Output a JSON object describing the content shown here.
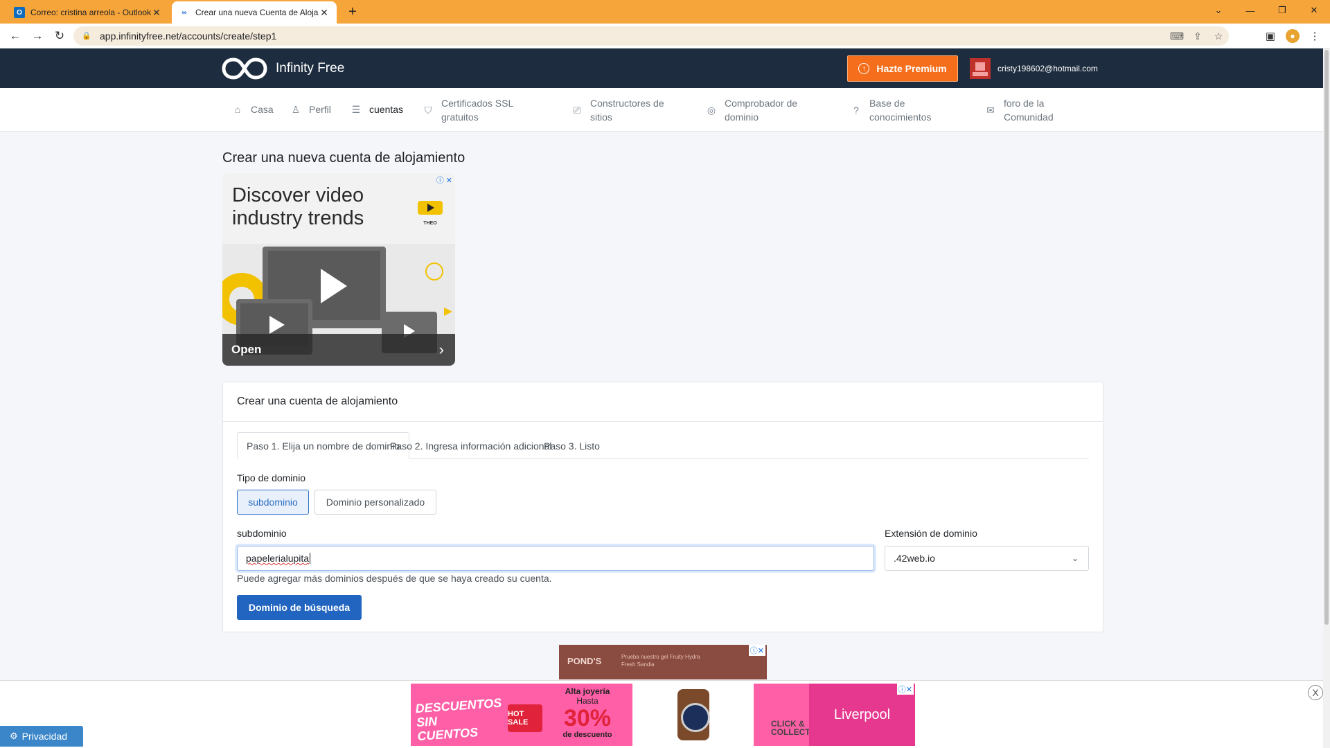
{
  "browser": {
    "tabs": [
      {
        "title": "Correo: cristina arreola - Outlook",
        "icon": "outlook-icon"
      },
      {
        "title": "Crear una nueva Cuenta de Alojamiento",
        "icon": "infinityfree-icon"
      }
    ],
    "new_tab": "+",
    "url": "app.infinityfree.net/accounts/create/step1"
  },
  "header": {
    "logo_text": "Infinity Free",
    "premium_label": "Hazte Premium",
    "user_email": "cristy198602@hotmail.com"
  },
  "nav": {
    "items": [
      {
        "label": "Casa",
        "icon": "home-icon"
      },
      {
        "label": "Perfil",
        "icon": "user-icon"
      },
      {
        "label": "cuentas",
        "icon": "server-icon"
      },
      {
        "label": "Certificados SSL gratuitos",
        "icon": "shield-icon"
      },
      {
        "label": "Constructores de sitios",
        "icon": "paint-roller-icon"
      },
      {
        "label": "Comprobador de dominio",
        "icon": "check-circle-icon"
      },
      {
        "label": "Base de conocimientos",
        "icon": "question-circle-icon"
      },
      {
        "label": "foro de la Comunidad",
        "icon": "chat-icon"
      }
    ]
  },
  "main": {
    "page_title": "Crear una nueva cuenta de alojamiento",
    "ad": {
      "headline": "Discover video industry trends",
      "cta": "Open",
      "logo_text": "THEO"
    },
    "card": {
      "title": "Crear una cuenta de alojamiento",
      "steps": [
        "Paso 1. Elija un nombre de dominio",
        "Paso 2. Ingresa información adicional",
        "Paso 3. Listo"
      ],
      "domain_type_label": "Tipo de dominio",
      "domain_types": [
        "subdominio",
        "Dominio personalizado"
      ],
      "subdomain_label": "subdominio",
      "subdomain_value": "papelerialupita",
      "extension_label": "Extensión de dominio",
      "extension_value": ".42web.io",
      "help_text": "Puede agregar más dominios después de que se haya creado su cuenta.",
      "search_button": "Dominio de búsqueda"
    },
    "small_ad": {
      "brand": "POND'S",
      "copy": "Prueba nuestro gel Fruity Hydra Fresh Sandia"
    }
  },
  "bottom": {
    "privacy_label": "Privacidad",
    "banner": {
      "left_text": "DESCUENTOS SIN CUENTOS",
      "hot_sale": "HOT SALE",
      "line1": "Alta joyería",
      "line2": "Hasta",
      "percent": "30%",
      "line4": "de descuento",
      "click": "CLICK & COLLECT",
      "brand": "Liverpool"
    },
    "close_label": "X"
  }
}
